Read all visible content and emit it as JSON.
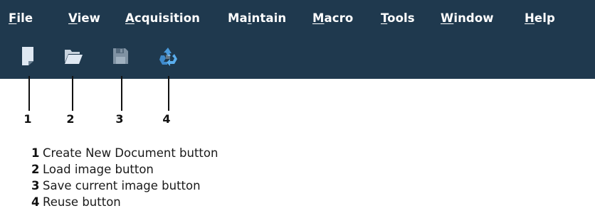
{
  "menubar": {
    "items": [
      {
        "accel": "F",
        "rest": "ile",
        "pre": ""
      },
      {
        "accel": "V",
        "rest": "iew",
        "pre": ""
      },
      {
        "accel": "A",
        "rest": "cquisition",
        "pre": ""
      },
      {
        "accel": "i",
        "rest": "ntain",
        "pre": "Ma"
      },
      {
        "accel": "M",
        "rest": "acro",
        "pre": ""
      },
      {
        "accel": "T",
        "rest": "ools",
        "pre": ""
      },
      {
        "accel": "W",
        "rest": "indow",
        "pre": ""
      },
      {
        "accel": "H",
        "rest": "elp",
        "pre": ""
      }
    ]
  },
  "toolbar": {
    "buttons": [
      {
        "icon": "new-document-icon"
      },
      {
        "icon": "folder-open-icon"
      },
      {
        "icon": "floppy-disk-icon"
      },
      {
        "icon": "recycle-arrows-icon"
      }
    ]
  },
  "callouts": {
    "numbers": [
      "1",
      "2",
      "3",
      "4"
    ]
  },
  "legend": {
    "items": [
      {
        "num": "1",
        "text": "Create New Document button"
      },
      {
        "num": "2",
        "text": "Load image button"
      },
      {
        "num": "3",
        "text": "Save current image button"
      },
      {
        "num": "4",
        "text": "Reuse button"
      }
    ]
  },
  "colors": {
    "app_bar": "#1f394e",
    "menu_text": "#ffffff",
    "icon_fill": "#dfe8f2",
    "icon_disabled": "#8a9cab",
    "reuse_blue": "#4a9bde"
  }
}
